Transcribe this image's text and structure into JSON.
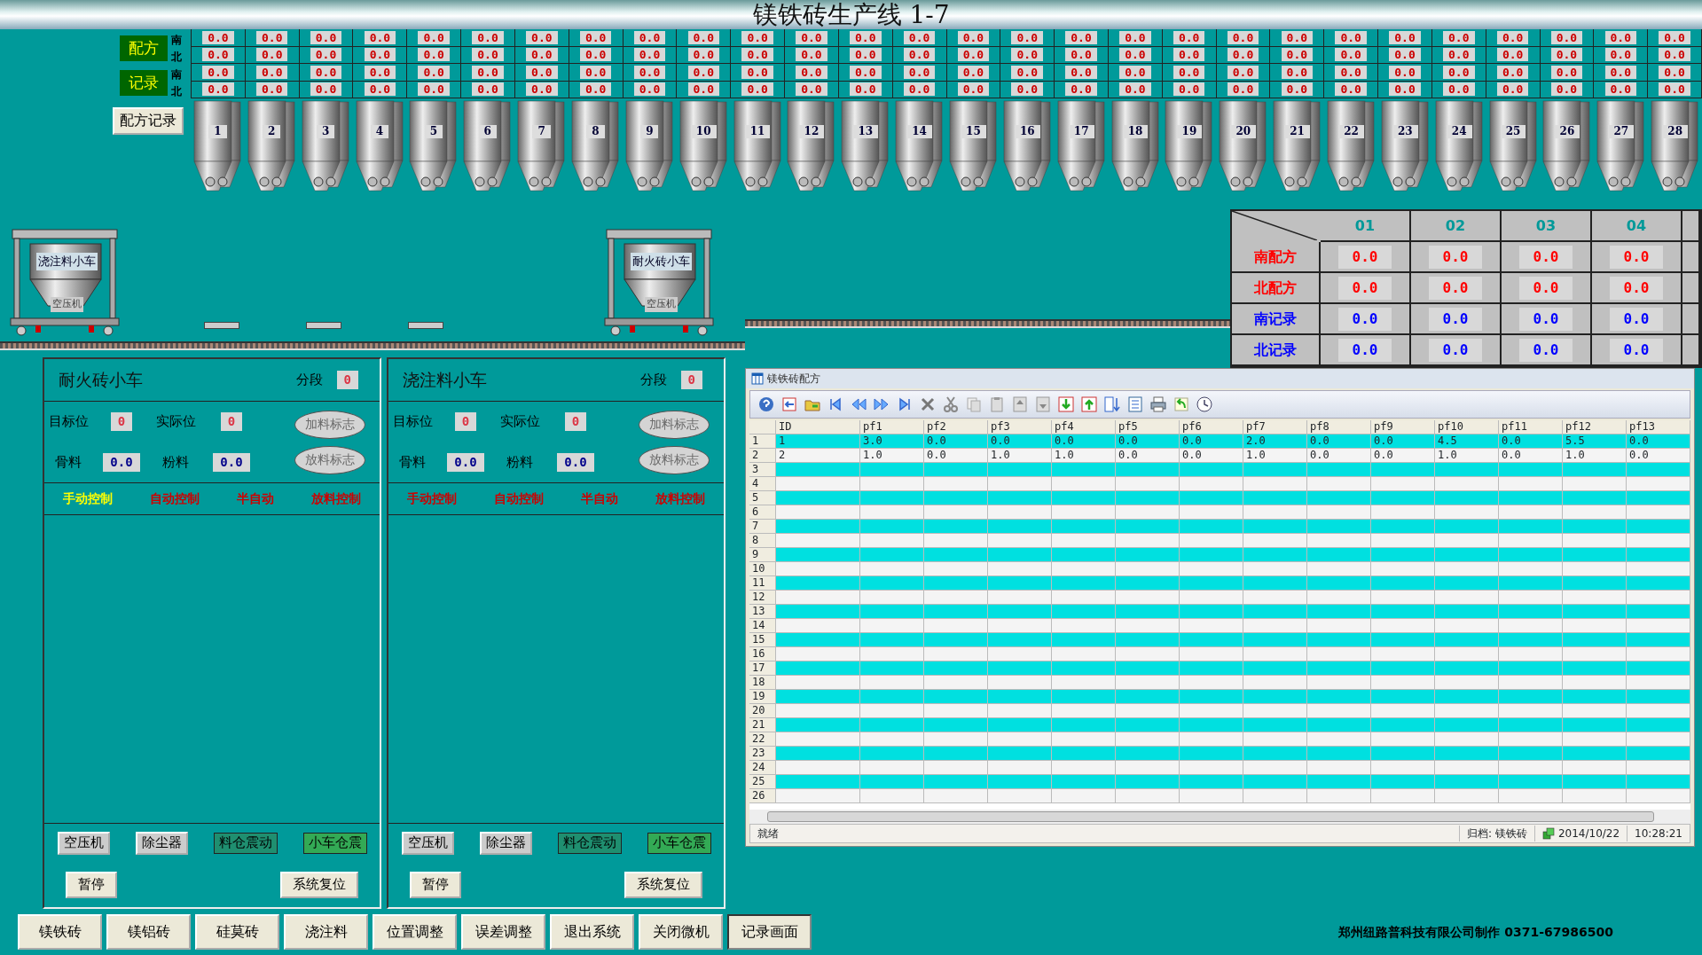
{
  "title": "镁铁砖生产线 1-7",
  "top_grid": {
    "groups": [
      {
        "label": "配方",
        "rows": [
          {
            "side": "南",
            "values": [
              "0.0",
              "0.0",
              "0.0",
              "0.0",
              "0.0",
              "0.0",
              "0.0",
              "0.0",
              "0.0",
              "0.0",
              "0.0",
              "0.0",
              "0.0",
              "0.0",
              "0.0",
              "0.0",
              "0.0",
              "0.0",
              "0.0",
              "0.0",
              "0.0",
              "0.0",
              "0.0",
              "0.0",
              "0.0",
              "0.0",
              "0.0",
              "0.0"
            ]
          },
          {
            "side": "北",
            "values": [
              "0.0",
              "0.0",
              "0.0",
              "0.0",
              "0.0",
              "0.0",
              "0.0",
              "0.0",
              "0.0",
              "0.0",
              "0.0",
              "0.0",
              "0.0",
              "0.0",
              "0.0",
              "0.0",
              "0.0",
              "0.0",
              "0.0",
              "0.0",
              "0.0",
              "0.0",
              "0.0",
              "0.0",
              "0.0",
              "0.0",
              "0.0",
              "0.0"
            ]
          }
        ]
      },
      {
        "label": "记录",
        "rows": [
          {
            "side": "南",
            "values": [
              "0.0",
              "0.0",
              "0.0",
              "0.0",
              "0.0",
              "0.0",
              "0.0",
              "0.0",
              "0.0",
              "0.0",
              "0.0",
              "0.0",
              "0.0",
              "0.0",
              "0.0",
              "0.0",
              "0.0",
              "0.0",
              "0.0",
              "0.0",
              "0.0",
              "0.0",
              "0.0",
              "0.0",
              "0.0",
              "0.0",
              "0.0",
              "0.0"
            ]
          },
          {
            "side": "北",
            "values": [
              "0.0",
              "0.0",
              "0.0",
              "0.0",
              "0.0",
              "0.0",
              "0.0",
              "0.0",
              "0.0",
              "0.0",
              "0.0",
              "0.0",
              "0.0",
              "0.0",
              "0.0",
              "0.0",
              "0.0",
              "0.0",
              "0.0",
              "0.0",
              "0.0",
              "0.0",
              "0.0",
              "0.0",
              "0.0",
              "0.0",
              "0.0",
              "0.0"
            ]
          }
        ]
      }
    ]
  },
  "recipe_record_button": "配方记录",
  "silos": [
    "1",
    "2",
    "3",
    "4",
    "5",
    "6",
    "7",
    "8",
    "9",
    "10",
    "11",
    "12",
    "13",
    "14",
    "15",
    "16",
    "17",
    "18",
    "19",
    "20",
    "21",
    "22",
    "23",
    "24",
    "25",
    "26",
    "27",
    "28"
  ],
  "carts": [
    {
      "label": "浇注料小车",
      "compressor": "空压机"
    },
    {
      "label": "耐火砖小车",
      "compressor": "空压机"
    }
  ],
  "summary": {
    "columns": [
      "01",
      "02",
      "03",
      "04"
    ],
    "rows": [
      {
        "label": "南配方",
        "color": "#ff0000",
        "values": [
          "0.0",
          "0.0",
          "0.0",
          "0.0"
        ]
      },
      {
        "label": "北配方",
        "color": "#ff0000",
        "values": [
          "0.0",
          "0.0",
          "0.0",
          "0.0"
        ]
      },
      {
        "label": "南记录",
        "color": "#0000ff",
        "values": [
          "0.0",
          "0.0",
          "0.0",
          "0.0"
        ]
      },
      {
        "label": "北记录",
        "color": "#0000ff",
        "values": [
          "0.0",
          "0.0",
          "0.0",
          "0.0"
        ]
      }
    ]
  },
  "panels": [
    {
      "title": "耐火砖小车",
      "segment_label": "分段",
      "segment_value": "0",
      "target_label": "目标位",
      "target_value": "0",
      "actual_label": "实际位",
      "actual_value": "0",
      "aggregate_label": "骨料",
      "aggregate_value": "0.0",
      "powder_label": "粉料",
      "powder_value": "0.0",
      "flags": [
        {
          "label": "加料标志",
          "on": false
        },
        {
          "label": "放料标志",
          "on": false
        }
      ],
      "modes": [
        {
          "label": "手动控制",
          "selected": true
        },
        {
          "label": "自动控制",
          "selected": false
        },
        {
          "label": "半自动",
          "selected": false
        },
        {
          "label": "放料控制",
          "selected": false
        }
      ],
      "devices": [
        {
          "label": "空压机",
          "kind": "button"
        },
        {
          "label": "除尘器",
          "kind": "button"
        },
        {
          "label": "料仓震动",
          "kind": "indicator",
          "on": false
        },
        {
          "label": "小车仓震",
          "kind": "indicator",
          "on": true
        }
      ],
      "actions": [
        "暂停",
        "系统复位"
      ]
    },
    {
      "title": "浇注料小车",
      "segment_label": "分段",
      "segment_value": "0",
      "target_label": "目标位",
      "target_value": "0",
      "actual_label": "实际位",
      "actual_value": "0",
      "aggregate_label": "骨料",
      "aggregate_value": "0.0",
      "powder_label": "粉料",
      "powder_value": "0.0",
      "flags": [
        {
          "label": "加料标志",
          "on": false
        },
        {
          "label": "放料标志",
          "on": false
        }
      ],
      "modes": [
        {
          "label": "手动控制",
          "selected": false
        },
        {
          "label": "自动控制",
          "selected": false
        },
        {
          "label": "半自动",
          "selected": false
        },
        {
          "label": "放料控制",
          "selected": false
        }
      ],
      "devices": [
        {
          "label": "空压机",
          "kind": "button"
        },
        {
          "label": "除尘器",
          "kind": "button"
        },
        {
          "label": "料仓震动",
          "kind": "indicator",
          "on": false
        },
        {
          "label": "小车仓震",
          "kind": "indicator",
          "on": true
        }
      ],
      "actions": [
        "暂停",
        "系统复位"
      ]
    }
  ],
  "table_window": {
    "title": "镁铁砖配方",
    "columns": [
      "ID",
      "pf1",
      "pf2",
      "pf3",
      "pf4",
      "pf5",
      "pf6",
      "pf7",
      "pf8",
      "pf9",
      "pf10",
      "pf11",
      "pf12",
      "pf13"
    ],
    "rows": [
      {
        "number": "1",
        "cells": [
          "1",
          "3.0",
          "0.0",
          "0.0",
          "0.0",
          "0.0",
          "0.0",
          "2.0",
          "0.0",
          "0.0",
          "4.5",
          "0.0",
          "5.5",
          "0.0"
        ]
      },
      {
        "number": "2",
        "cells": [
          "2",
          "1.0",
          "0.0",
          "1.0",
          "1.0",
          "0.0",
          "0.0",
          "1.0",
          "0.0",
          "0.0",
          "1.0",
          "0.0",
          "1.0",
          "0.0"
        ]
      },
      {
        "number": "3",
        "cells": []
      },
      {
        "number": "4",
        "cells": []
      },
      {
        "number": "5",
        "cells": []
      },
      {
        "number": "6",
        "cells": []
      },
      {
        "number": "7",
        "cells": []
      },
      {
        "number": "8",
        "cells": []
      },
      {
        "number": "9",
        "cells": []
      },
      {
        "number": "10",
        "cells": []
      },
      {
        "number": "11",
        "cells": []
      },
      {
        "number": "12",
        "cells": []
      },
      {
        "number": "13",
        "cells": []
      },
      {
        "number": "14",
        "cells": []
      },
      {
        "number": "15",
        "cells": []
      },
      {
        "number": "16",
        "cells": []
      },
      {
        "number": "17",
        "cells": []
      },
      {
        "number": "18",
        "cells": []
      },
      {
        "number": "19",
        "cells": []
      },
      {
        "number": "20",
        "cells": []
      },
      {
        "number": "21",
        "cells": []
      },
      {
        "number": "22",
        "cells": []
      },
      {
        "number": "23",
        "cells": []
      },
      {
        "number": "24",
        "cells": []
      },
      {
        "number": "25",
        "cells": []
      },
      {
        "number": "26",
        "cells": []
      }
    ],
    "status": {
      "message": "就绪",
      "archive": "归档: 镁铁砖",
      "date": "2014/10/22",
      "time": "10:28:21"
    }
  },
  "footer_buttons": [
    {
      "label": "镁铁砖",
      "selected": false
    },
    {
      "label": "镁铝砖",
      "selected": false
    },
    {
      "label": "硅莫砖",
      "selected": false
    },
    {
      "label": "浇注料",
      "selected": false
    },
    {
      "label": "位置调整",
      "selected": false
    },
    {
      "label": "误差调整",
      "selected": false
    },
    {
      "label": "退出系统",
      "selected": false
    },
    {
      "label": "关闭微机",
      "selected": false
    },
    {
      "label": "记录画面",
      "selected": true
    }
  ],
  "credit": "郑州纽路普科技有限公司制作  0371-67986500"
}
